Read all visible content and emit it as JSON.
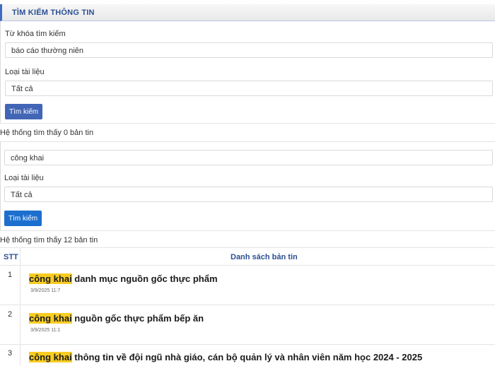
{
  "header": {
    "title": "TÌM KIẾM THÔNG TIN"
  },
  "search1": {
    "keyword_label": "Từ khóa tìm kiếm",
    "keyword_value": "báo cáo thường niên",
    "type_label": "Loại tài liệu",
    "type_value": "Tất cả",
    "button_label": "Tìm kiếm",
    "result_text": "Hệ thống tìm thấy 0 bản tin"
  },
  "search2": {
    "keyword_value": "công khai",
    "type_label": "Loại tài liệu",
    "type_value": "Tất cả",
    "button_label": "Tìm kiếm",
    "result_text": "Hệ thống tìm thấy 12 bản tin"
  },
  "table": {
    "col_stt": "STT",
    "col_list": "Danh sách bản tin",
    "rows": [
      {
        "num": "1",
        "highlight": "công khai",
        "rest": " danh mục nguồn gốc thực phẩm",
        "date": "3/9/2025 11:7"
      },
      {
        "num": "2",
        "highlight": "công khai",
        "rest": " nguồn gốc thực phẩm bếp ăn",
        "date": "3/9/2025 11:1"
      },
      {
        "num": "3",
        "highlight": "công khai",
        "rest": " thông tin về đội ngũ nhà giáo, cán bộ quản lý và nhân viên năm học 2024 - 2025",
        "date": ""
      }
    ]
  },
  "colors": {
    "accent": "#3f6cc0",
    "button_primary": "#4265b5",
    "button_secondary": "#1d6fce",
    "highlight": "#f8cd21",
    "header_text": "#2b4f94"
  }
}
